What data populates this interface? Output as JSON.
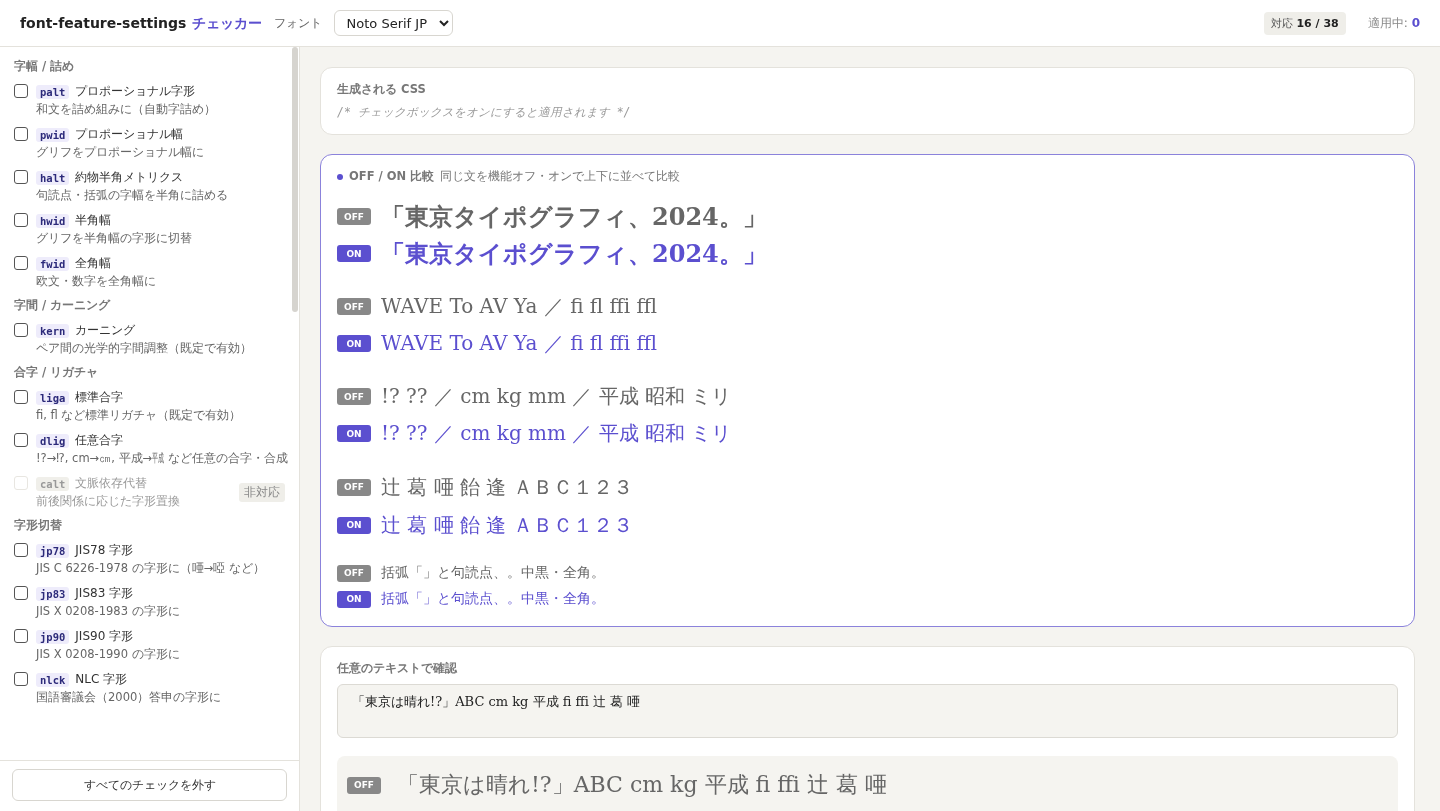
{
  "header": {
    "title": "font-feature-settings",
    "title_accent": "チェッカー",
    "font_label": "フォント",
    "font_select": {
      "value": "Noto Serif JP"
    },
    "support_label": "対応",
    "support_count": "16 / 38",
    "active_label": "適用中:",
    "active_count": "0"
  },
  "sidebar": {
    "groups": [
      {
        "heading": "字幅 / 詰め",
        "items": [
          {
            "tag": "palt",
            "name": "プロポーショナル字形",
            "desc": "和文を詰め組みに（自動字詰め）",
            "checked": false,
            "disabled": false
          },
          {
            "tag": "pwid",
            "name": "プロポーショナル幅",
            "desc": "グリフをプロポーショナル幅に",
            "checked": false,
            "disabled": false
          },
          {
            "tag": "halt",
            "name": "約物半角メトリクス",
            "desc": "句読点・括弧の字幅を半角に詰める",
            "checked": false,
            "disabled": false
          },
          {
            "tag": "hwid",
            "name": "半角幅",
            "desc": "グリフを半角幅の字形に切替",
            "checked": false,
            "disabled": false
          },
          {
            "tag": "fwid",
            "name": "全角幅",
            "desc": "欧文・数字を全角幅に",
            "checked": false,
            "disabled": false
          }
        ]
      },
      {
        "heading": "字間 / カーニング",
        "items": [
          {
            "tag": "kern",
            "name": "カーニング",
            "desc": "ペア間の光学的字間調整（既定で有効）",
            "checked": false,
            "disabled": false
          }
        ]
      },
      {
        "heading": "合字 / リガチャ",
        "items": [
          {
            "tag": "liga",
            "name": "標準合字",
            "desc": "fi, fl など標準リガチャ（既定で有効）",
            "checked": false,
            "disabled": false
          },
          {
            "tag": "dlig",
            "name": "任意合字",
            "desc": "!?→⁉, cm→㎝, 平成→㍻ など任意の合字・合成",
            "checked": false,
            "disabled": false
          },
          {
            "tag": "calt",
            "name": "文脈依存代替",
            "desc": "前後関係に応じた字形置換",
            "checked": false,
            "disabled": true,
            "badge": "非対応"
          }
        ]
      },
      {
        "heading": "字形切替",
        "items": [
          {
            "tag": "jp78",
            "name": "JIS78 字形",
            "desc": "JIS C 6226-1978 の字形に（唖→啞 など）",
            "checked": false,
            "disabled": false
          },
          {
            "tag": "jp83",
            "name": "JIS83 字形",
            "desc": "JIS X 0208-1983 の字形に",
            "checked": false,
            "disabled": false
          },
          {
            "tag": "jp90",
            "name": "JIS90 字形",
            "desc": "JIS X 0208-1990 の字形に",
            "checked": false,
            "disabled": false
          },
          {
            "tag": "nlck",
            "name": "NLC 字形",
            "desc": "国語審議会（2000）答申の字形に",
            "checked": false,
            "disabled": false
          }
        ]
      }
    ],
    "clear_button": "すべてのチェックを外す"
  },
  "css_panel": {
    "label": "生成される CSS",
    "code": "/* チェックボックスをオンにすると適用されます */"
  },
  "comparison": {
    "title": "OFF / ON 比較",
    "subtitle": "同じ文を機能オフ・オンで上下に並べて比較",
    "groups": [
      {
        "off_label": "OFF",
        "off": "「東京タイポグラフィ、2024。」",
        "on_label": "ON",
        "on": "「東京タイポグラフィ、2024。」"
      },
      {
        "off_label": "OFF",
        "off": "WAVE To AV Ya ／ fi fl ffi ffl",
        "on_label": "ON",
        "on": "WAVE To AV Ya ／ fi fl ffi ffl"
      },
      {
        "off_label": "OFF",
        "off": "!? ?? ／ cm kg mm ／ 平成 昭和 ミリ",
        "on_label": "ON",
        "on": "!? ?? ／ cm kg mm ／ 平成 昭和 ミリ"
      },
      {
        "off_label": "OFF",
        "off": "辻 葛 唖 飴 逢 ＡＢＣ１２３",
        "on_label": "ON",
        "on": "辻 葛 唖 飴 逢 ＡＢＣ１２３"
      },
      {
        "off_label": "OFF",
        "off": "括弧「」と句読点、。中黒・全角。",
        "on_label": "ON",
        "on": "括弧「」と句読点、。中黒・全角。"
      }
    ]
  },
  "custom_text": {
    "label": "任意のテキストで確認",
    "value": "「東京は晴れ!?」ABC cm kg 平成 fi ffi 辻 葛 唖",
    "preview_off_label": "OFF",
    "preview_off": "「東京は晴れ!?」ABC cm kg 平成 fi ffi 辻 葛 唖"
  }
}
